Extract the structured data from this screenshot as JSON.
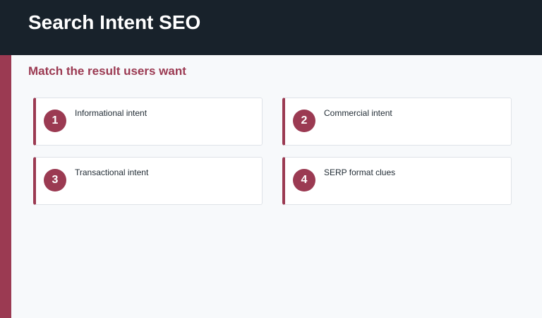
{
  "header": {
    "title": "Search Intent SEO"
  },
  "main": {
    "subtitle": "Match the result users want",
    "cards": [
      {
        "number": "1",
        "label": "Informational intent"
      },
      {
        "number": "2",
        "label": "Commercial intent"
      },
      {
        "number": "3",
        "label": "Transactional intent"
      },
      {
        "number": "4",
        "label": "SERP format clues"
      }
    ]
  },
  "colors": {
    "header_bg": "#18222b",
    "accent": "#9b3a52",
    "page_bg": "#f7f9fb",
    "card_bg": "#ffffff"
  }
}
